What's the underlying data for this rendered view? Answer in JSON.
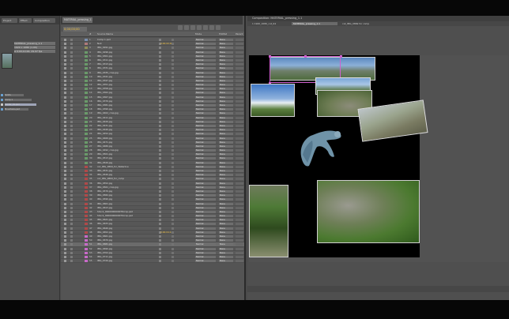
{
  "project": {
    "tabs": [
      "Project",
      "Effect",
      "Composition"
    ],
    "file_lines": [
      "MATERIAL_pressing_1.1",
      "1920 x 1080 (1.00)",
      "Δ 0;00;10;00, 29.97 fps"
    ],
    "items": [
      "Solids",
      "Comp 1",
      "render_01.psd",
      "Mountains.psd"
    ]
  },
  "timeline": {
    "tab_label": "MATERIAL_pressing_1.1",
    "timecode": "0;00;00;00",
    "columns": {
      "num": "#",
      "source": "Source Name",
      "mode": "Mode",
      "trkmat": "TrkMat",
      "parent": "Parent"
    },
    "layers": [
      {
        "num": "1",
        "name": "Comp 1.psd",
        "mode": "Normal",
        "trk": "None",
        "color": "#7a8fb0",
        "time": ""
      },
      {
        "num": "2",
        "name": "Null",
        "mode": "Normal",
        "trk": "None",
        "color": "#b07a7a",
        "time": "0;00;00;00"
      },
      {
        "num": "3",
        "name": "IMG_0291.jpg",
        "mode": "Normal",
        "trk": "None",
        "color": "#8f8f5a",
        "time": ""
      },
      {
        "num": "4",
        "name": "IMG_0296.jpg",
        "mode": "Normal",
        "trk": "None",
        "color": "#6a9a6a",
        "time": ""
      },
      {
        "num": "5",
        "name": "IMG_0301.jpg",
        "mode": "Normal",
        "trk": "None",
        "color": "#6a9a6a",
        "time": ""
      },
      {
        "num": "6",
        "name": "IMG_0311.jpg",
        "mode": "Normal",
        "trk": "None",
        "color": "#6a9a6a",
        "time": ""
      },
      {
        "num": "7",
        "name": "IMG_0313.jpg",
        "mode": "Normal",
        "trk": "None",
        "color": "#6a9a6a",
        "time": ""
      },
      {
        "num": "8",
        "name": "IMG_0331.jpg",
        "mode": "Normal",
        "trk": "None",
        "color": "#6a9a6a",
        "time": ""
      },
      {
        "num": "9",
        "name": "IMG_0335_crop.jpg",
        "mode": "Normal",
        "trk": "None",
        "color": "#6a9a6a",
        "time": ""
      },
      {
        "num": "10",
        "name": "IMG_0341.jpg",
        "mode": "Normal",
        "trk": "None",
        "color": "#6a9a6a",
        "time": ""
      },
      {
        "num": "11",
        "name": "IMG_0347.jpg",
        "mode": "Normal",
        "trk": "None",
        "color": "#6a9a6a",
        "time": ""
      },
      {
        "num": "12",
        "name": "IMG_0351.jpg",
        "mode": "Normal",
        "trk": "None",
        "color": "#6a9a6a",
        "time": ""
      },
      {
        "num": "13",
        "name": "IMG_0358.jpg",
        "mode": "Normal",
        "trk": "None",
        "color": "#6a9a6a",
        "time": ""
      },
      {
        "num": "14",
        "name": "IMG_0362.jpg",
        "mode": "Normal",
        "trk": "None",
        "color": "#6a9a6a",
        "time": ""
      },
      {
        "num": "15",
        "name": "IMG_0367.jpg",
        "mode": "Normal",
        "trk": "None",
        "color": "#6a9a6a",
        "time": ""
      },
      {
        "num": "16",
        "name": "IMG_0370.jpg",
        "mode": "Normal",
        "trk": "None",
        "color": "#6a9a6a",
        "time": ""
      },
      {
        "num": "17",
        "name": "IMG_0381.jpg",
        "mode": "Normal",
        "trk": "None",
        "color": "#6a9a6a",
        "time": ""
      },
      {
        "num": "18",
        "name": "IMG_0390.jpg",
        "mode": "Normal",
        "trk": "None",
        "color": "#6a9a6a",
        "time": ""
      },
      {
        "num": "19",
        "name": "IMG_0402_crop.jpg",
        "mode": "Normal",
        "trk": "None",
        "color": "#6a9a6a",
        "time": ""
      },
      {
        "num": "20",
        "name": "IMG_0411.jpg",
        "mode": "Normal",
        "trk": "None",
        "color": "#6a9a6a",
        "time": ""
      },
      {
        "num": "21",
        "name": "IMG_0420.jpg",
        "mode": "Normal",
        "trk": "None",
        "color": "#6a9a6a",
        "time": ""
      },
      {
        "num": "22",
        "name": "IMG_0431.jpg",
        "mode": "Normal",
        "trk": "None",
        "color": "#6a9a6a",
        "time": ""
      },
      {
        "num": "23",
        "name": "IMG_0440.jpg",
        "mode": "Normal",
        "trk": "None",
        "color": "#6a9a6a",
        "time": ""
      },
      {
        "num": "24",
        "name": "IMG_0452.jpg",
        "mode": "Normal",
        "trk": "None",
        "color": "#6a9a6a",
        "time": ""
      },
      {
        "num": "25",
        "name": "IMG_0460.jpg",
        "mode": "Normal",
        "trk": "None",
        "color": "#6a9a6a",
        "time": ""
      },
      {
        "num": "26",
        "name": "IMG_0471.jpg",
        "mode": "Normal",
        "trk": "None",
        "color": "#6a9a6a",
        "time": ""
      },
      {
        "num": "27",
        "name": "IMG_0480.jpg",
        "mode": "Normal",
        "trk": "None",
        "color": "#6a9a6a",
        "time": ""
      },
      {
        "num": "28",
        "name": "IMG_0492_crop.jpg",
        "mode": "Normal",
        "trk": "None",
        "color": "#6a9a6a",
        "time": ""
      },
      {
        "num": "29",
        "name": "IMG_0501.jpg",
        "mode": "Normal",
        "trk": "None",
        "color": "#6a9a6a",
        "time": ""
      },
      {
        "num": "30",
        "name": "IMG_0513.jpg",
        "mode": "Normal",
        "trk": "None",
        "color": "#6a9a6a",
        "time": ""
      },
      {
        "num": "31",
        "name": "IMG_0520.jpg",
        "mode": "Normal",
        "trk": "None",
        "color": "#6a9a6a",
        "time": ""
      },
      {
        "num": "32",
        "name": "cut_IMG_0869_for_Waterline",
        "mode": "Normal",
        "trk": "None",
        "color": "#b04a4a",
        "time": ""
      },
      {
        "num": "33",
        "name": "IMG_0531.jpg",
        "mode": "Normal",
        "trk": "None",
        "color": "#b04a4a",
        "time": ""
      },
      {
        "num": "34",
        "name": "IMG_0540.jpg",
        "mode": "Normal",
        "trk": "None",
        "color": "#b04a4a",
        "time": ""
      },
      {
        "num": "35",
        "name": "cut_IMG_0869_for_comp",
        "mode": "Normal",
        "trk": "None",
        "color": "#b04a4a",
        "time": ""
      },
      {
        "num": "36",
        "name": "IMG_0552.jpg",
        "mode": "Normal",
        "trk": "None",
        "color": "#b04a4a",
        "time": ""
      },
      {
        "num": "37",
        "name": "IMG_0561_crop.jpg",
        "mode": "Normal",
        "trk": "None",
        "color": "#b04a4a",
        "time": ""
      },
      {
        "num": "38",
        "name": "IMG_0570.jpg",
        "mode": "Normal",
        "trk": "None",
        "color": "#b04a4a",
        "time": ""
      },
      {
        "num": "39",
        "name": "IMG_0582.jpg",
        "mode": "Normal",
        "trk": "None",
        "color": "#b04a4a",
        "time": ""
      },
      {
        "num": "40",
        "name": "IMG_0590.jpg",
        "mode": "Normal",
        "trk": "None",
        "color": "#b04a4a",
        "time": ""
      },
      {
        "num": "41",
        "name": "IMG_0601.jpg",
        "mode": "Normal",
        "trk": "None",
        "color": "#b04a4a",
        "time": ""
      },
      {
        "num": "42",
        "name": "IMG_0613.jpg",
        "mode": "Normal",
        "trk": "None",
        "color": "#b04a4a",
        "time": ""
      },
      {
        "num": "43",
        "name": "Shock_0000000000078crop.psd",
        "mode": "Normal",
        "trk": "None",
        "color": "#b04a4a",
        "time": ""
      },
      {
        "num": "44",
        "name": "Shock_0000000000079crop.psd",
        "mode": "Normal",
        "trk": "None",
        "color": "#b04a4a",
        "time": ""
      },
      {
        "num": "45",
        "name": "IMG_0621.jpg",
        "mode": "Normal",
        "trk": "None",
        "color": "#b04a4a",
        "time": ""
      },
      {
        "num": "46",
        "name": "IMG_0633.jpg",
        "mode": "Normal",
        "trk": "None",
        "color": "#b04a4a",
        "time": ""
      },
      {
        "num": "47",
        "name": "IMG_0640.jpg",
        "mode": "Normal",
        "trk": "None",
        "color": "#b04a4a",
        "time": ""
      },
      {
        "num": "48",
        "name": "IMG_0652.jpg",
        "mode": "Normal",
        "trk": "None",
        "color": "#b04a4a",
        "time": "0;00;04;12"
      },
      {
        "num": "49",
        "name": "IMG_0661.jpg",
        "mode": "Normal",
        "trk": "None",
        "color": "#c86ac8",
        "time": ""
      },
      {
        "num": "50",
        "name": "IMG_0670.jpg",
        "mode": "Normal",
        "trk": "None",
        "color": "#c86ac8",
        "time": ""
      },
      {
        "num": "51",
        "name": "IMG_0681.jpg",
        "mode": "Normal",
        "trk": "None",
        "color": "#c86ac8",
        "time": ""
      },
      {
        "num": "52",
        "name": "IMG_0690.jpg",
        "mode": "Normal",
        "trk": "None",
        "color": "#c86ac8",
        "time": ""
      },
      {
        "num": "53",
        "name": "IMG_0702.jpg",
        "mode": "Normal",
        "trk": "None",
        "color": "#c86ac8",
        "time": ""
      },
      {
        "num": "54",
        "name": "IMG_0711.jpg",
        "mode": "Normal",
        "trk": "None",
        "color": "#c86ac8",
        "time": ""
      },
      {
        "num": "55",
        "name": "IMG_0720.jpg",
        "mode": "Normal",
        "trk": "None",
        "color": "#c86ac8",
        "time": ""
      }
    ],
    "selected_index": 50
  },
  "comp": {
    "title": "Composition: MATERIAL_pressing_1.1",
    "tabs": [
      "1 1920_1080_cut_04",
      "MATERIAL_pressing_1.1",
      "cut_IMG_0869 for comp"
    ],
    "active_tab": 1
  },
  "colors": {
    "accent": "#f0c040",
    "selection": "#d060d0"
  }
}
